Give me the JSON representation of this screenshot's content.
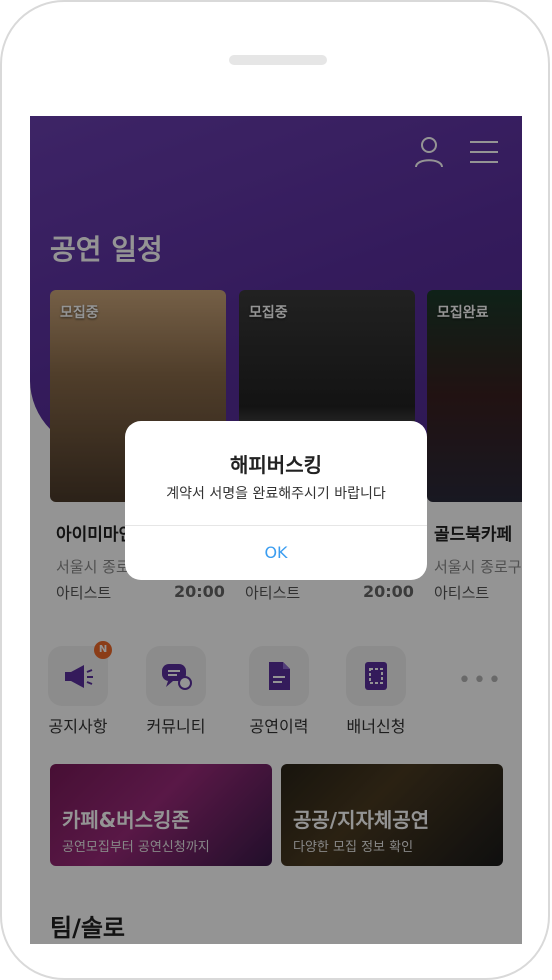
{
  "header": {
    "section_title": "공연 일정"
  },
  "schedule_cards": [
    {
      "badge": "모집중",
      "venue": "아이미마인",
      "location": "서울시 종로",
      "artist": "아티스트",
      "time": "20:00"
    },
    {
      "badge": "모집중",
      "venue": "",
      "location": "",
      "artist": "아티스트",
      "time": "20:00"
    },
    {
      "badge": "모집완료",
      "venue": "골드북카페",
      "location": "서울시 종로구",
      "artist": "아티스트",
      "time": ""
    }
  ],
  "quick_menu": [
    {
      "label": "공지사항",
      "icon": "megaphone-icon",
      "badge": "N"
    },
    {
      "label": "커뮤니티",
      "icon": "chat-bubbles-icon"
    },
    {
      "label": "공연이력",
      "icon": "document-icon"
    },
    {
      "label": "배너신청",
      "icon": "banner-icon"
    },
    {
      "label": "",
      "icon": "more-dots-icon"
    }
  ],
  "banners": [
    {
      "title": "카페&버스킹존",
      "subtitle": "공연모집부터 공연신청까지"
    },
    {
      "title": "공공/지자체공연",
      "subtitle": "다양한 모집 정보 확인"
    }
  ],
  "team_section_title": "팀/솔로",
  "dialog": {
    "title": "해피버스킹",
    "message": "계약서 서명을 완료해주시기 바랍니다",
    "ok_label": "OK"
  },
  "colors": {
    "accent": "#5a2f9e",
    "dialog_ok": "#3b9df0",
    "badge": "#ef6a2a"
  }
}
